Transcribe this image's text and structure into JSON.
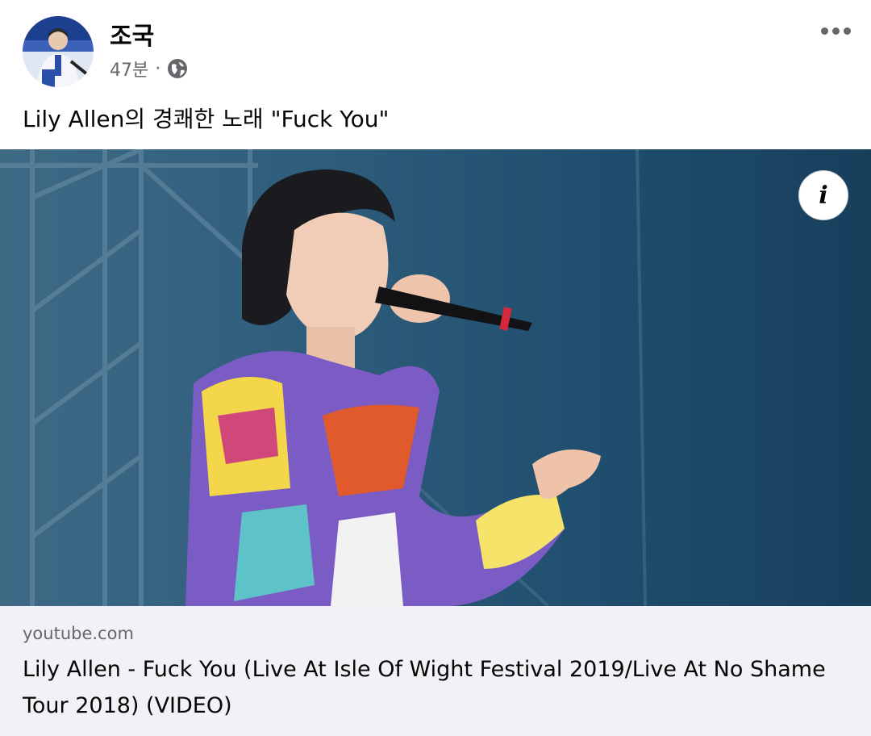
{
  "post": {
    "author": "조국",
    "time": "47분",
    "separator": "·",
    "privacy_icon": "globe-icon",
    "text": "Lily Allen의 경쾌한 노래 \"Fuck You\""
  },
  "link": {
    "domain": "youtube.com",
    "title": "Lily Allen - Fuck You (Live At Isle Of Wight Festival 2019/Live At No Shame Tour 2018) (VIDEO)"
  },
  "media": {
    "info_label": "i"
  },
  "colors": {
    "text_primary": "#050505",
    "text_secondary": "#65676b",
    "card_background": "#f0f2f5"
  }
}
